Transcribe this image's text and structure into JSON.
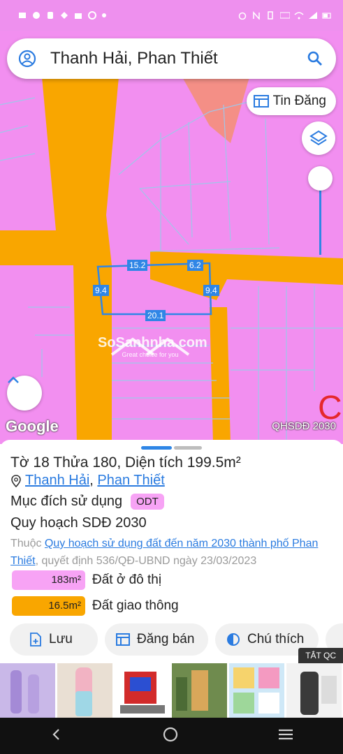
{
  "search": {
    "query": "Thanh Hải, Phan Thiết"
  },
  "map": {
    "tin_dang_label": "Tin Đăng",
    "layer_label": "QHSDĐ 2030",
    "google_logo": "Google",
    "watermark_name": "SoSanhnha.com",
    "watermark_tagline": "Great choice for you",
    "dimensions": [
      "15.2",
      "6.2",
      "9.4",
      "9.4",
      "20.1"
    ]
  },
  "parcel": {
    "title": "Tờ 18 Thửa 180, Diện tích 199.5m²",
    "ward": "Thanh Hải",
    "separator": ", ",
    "city": "Phan Thiết",
    "purpose_label": "Mục đích sử dụng",
    "purpose_code": "ODT",
    "plan_title": "Quy hoạch SDĐ 2030",
    "note_prefix": "Thuộc ",
    "note_link": "Quy hoạch sử dụng đất đến năm 2030 thành phố Phan Thiết",
    "note_suffix": ", quyết định 536/QĐ-UBND ngày 23/03/2023",
    "areas": [
      {
        "value": "183m²",
        "label": "Đất ở đô thị",
        "color": "#f7a3f5"
      },
      {
        "value": "16.5m²",
        "label": "Đất giao thông",
        "color": "#f9a600"
      }
    ]
  },
  "actions": {
    "save": "Lưu",
    "post_sale": "Đăng bán",
    "legend": "Chú thích"
  },
  "ad": {
    "label": "TẮT QC"
  },
  "colors": {
    "map_pink": "#f28ff0",
    "road_orange": "#f9a600",
    "accent_blue": "#2f86e6",
    "link_blue": "#2a7be0"
  }
}
